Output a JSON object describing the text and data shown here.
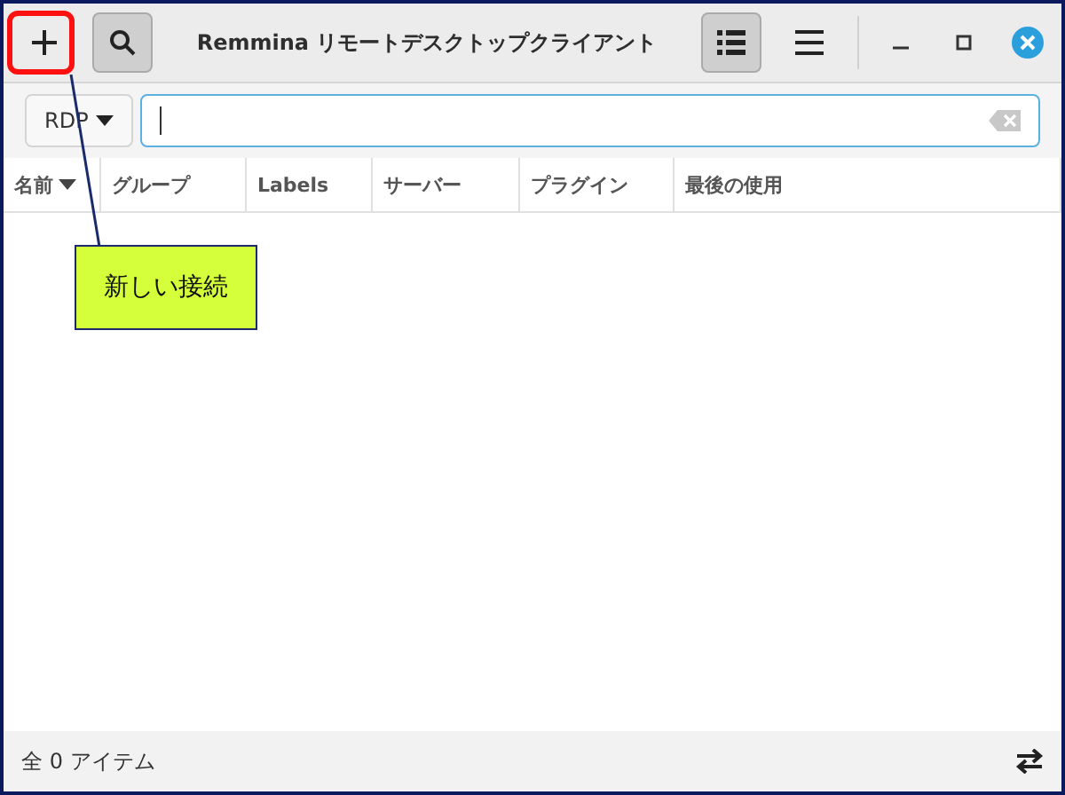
{
  "window": {
    "title": "Remmina リモートデスクトップクライアント"
  },
  "header_left": [
    {
      "kind": "new",
      "pressed": false
    },
    {
      "kind": "search",
      "pressed": true
    }
  ],
  "header_right": [
    {
      "kind": "list-view",
      "pressed": true
    },
    {
      "kind": "menu",
      "pressed": false
    }
  ],
  "filter": {
    "protocol": "RDP"
  },
  "table": {
    "columns": [
      {
        "label": "名前",
        "sorted": true
      },
      {
        "label": "グループ",
        "sorted": false
      },
      {
        "label": "Labels",
        "sorted": false
      },
      {
        "label": "サーバー",
        "sorted": false
      },
      {
        "label": "プラグイン",
        "sorted": false
      },
      {
        "label": "最後の使用",
        "sorted": false
      }
    ]
  },
  "status_bar": {
    "text": "全 0 アイテム"
  },
  "callout": {
    "text": "新しい接続"
  }
}
